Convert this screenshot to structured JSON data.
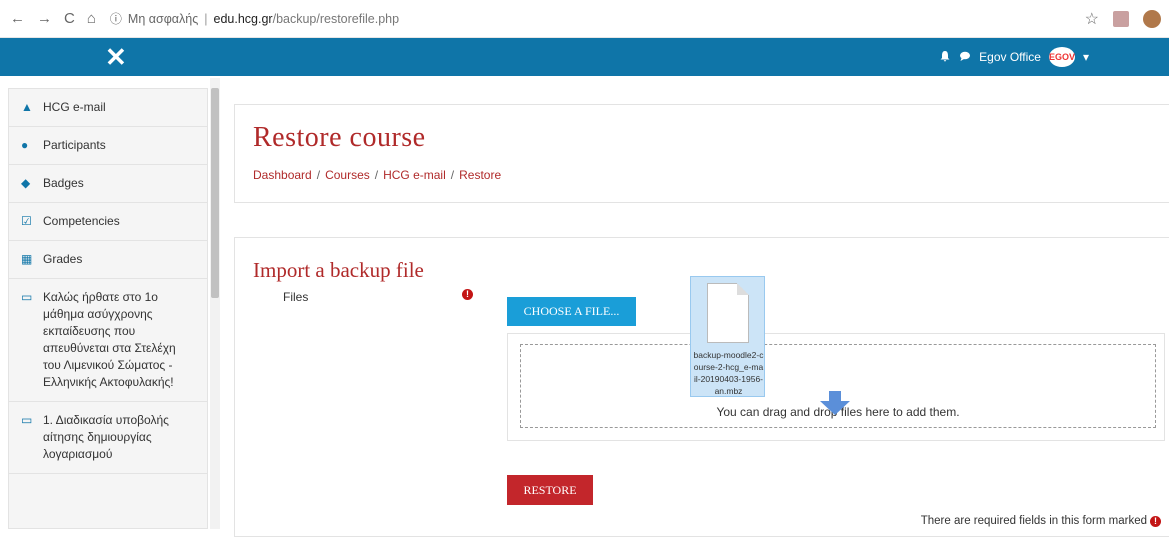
{
  "browser": {
    "security_label": "Μη ασφαλής",
    "url_host": "edu.hcg.gr",
    "url_path": "/backup/restorefile.php"
  },
  "topnav": {
    "user_name": "Egov Office",
    "avatar_text": "EGOV"
  },
  "sidebar": {
    "items": [
      {
        "label": "HCG e-mail",
        "icon": "graduation-cap-icon"
      },
      {
        "label": "Participants",
        "icon": "users-icon"
      },
      {
        "label": "Badges",
        "icon": "shield-icon"
      },
      {
        "label": "Competencies",
        "icon": "check-square-icon"
      },
      {
        "label": "Grades",
        "icon": "table-icon"
      },
      {
        "label": "Καλώς ήρθατε στο 1ο μάθημα ασύγχρονης εκπαίδευσης που απευθύνεται στα Στελέχη του Λιμενικού Σώματος - Ελληνικής Ακτοφυλακής!",
        "icon": "folder-icon"
      },
      {
        "label": "1. Διαδικασία υποβολής αίτησης δημιουργίας λογαριασμού",
        "icon": "folder-icon"
      }
    ]
  },
  "page": {
    "title": "Restore course",
    "breadcrumb": [
      "Dashboard",
      "Courses",
      "HCG e-mail",
      "Restore"
    ]
  },
  "import": {
    "heading": "Import a backup file",
    "files_label": "Files",
    "choose_label": "CHOOSE A FILE...",
    "drop_text": "You can drag and drop files here to add them.",
    "dragged_file": "backup-moodle2-course-2-hcg_e-mail-20190403-1956-an.mbz",
    "restore_label": "RESTORE",
    "required_note": "There are required fields in this form marked"
  },
  "colors": {
    "nav_bar": "#0f75a8",
    "heading": "#b02a2a",
    "choose_button": "#1a9ed8",
    "restore_button": "#c3262b"
  }
}
